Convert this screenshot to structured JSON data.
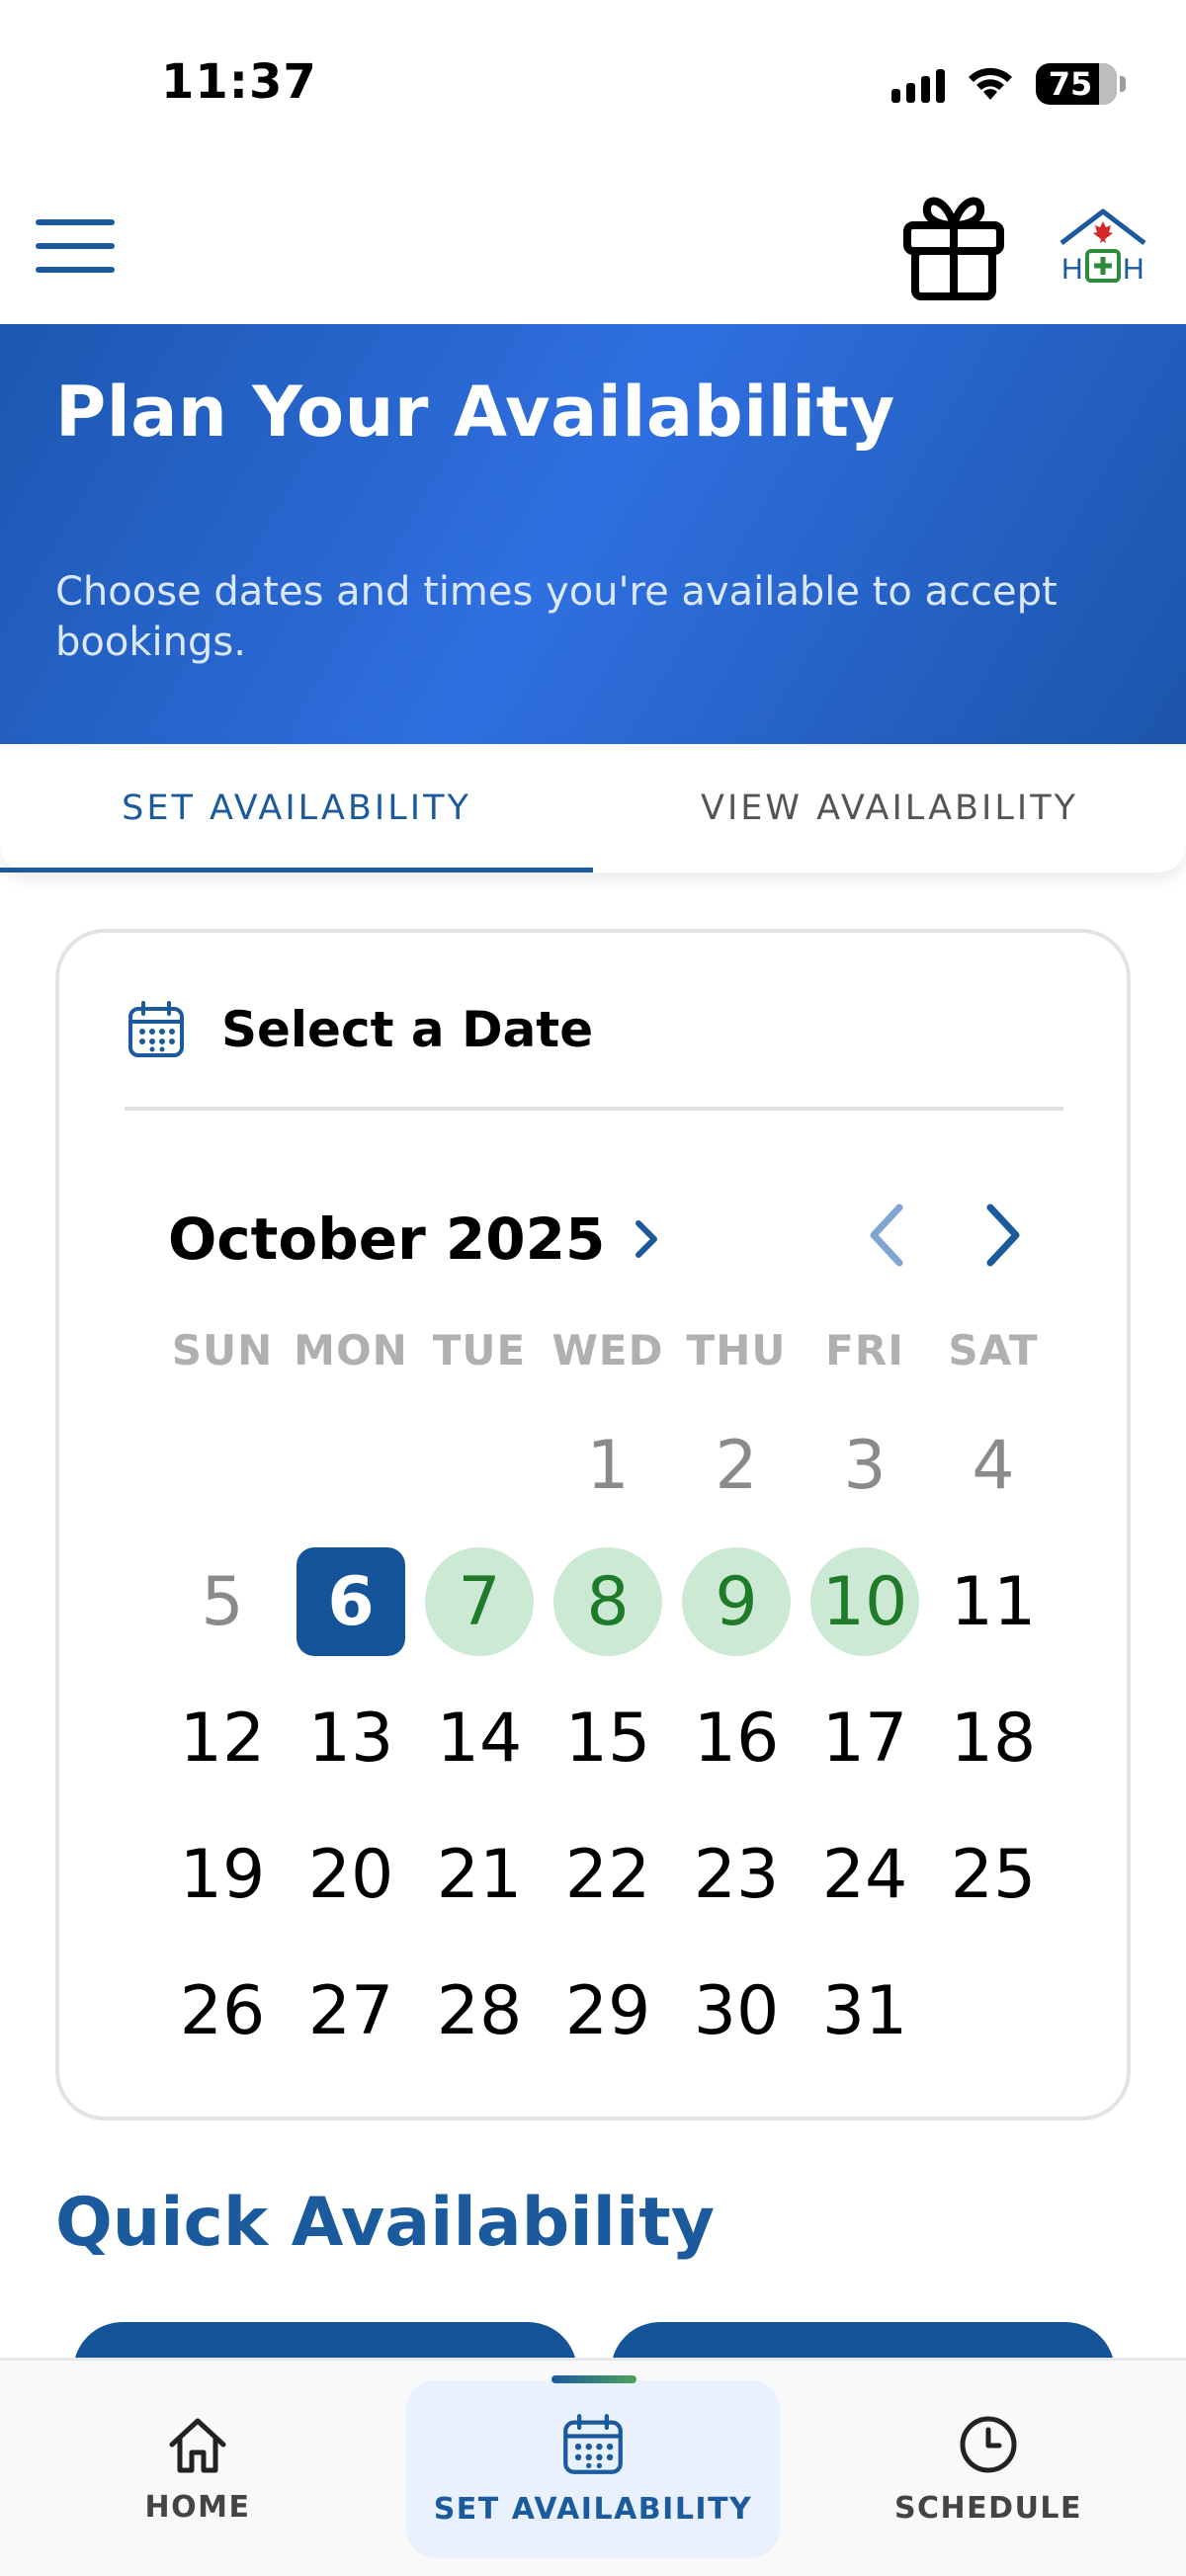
{
  "status_bar": {
    "time": "11:37",
    "battery": "75"
  },
  "header": {
    "menu_icon": "hamburger-menu-icon",
    "gift_icon": "gift-icon",
    "logo_icon": "house-maple-leaf-logo"
  },
  "hero": {
    "title": "Plan Your Availability",
    "subtitle": "Choose dates and times you're available to accept bookings."
  },
  "tabs": [
    {
      "label": "SET AVAILABILITY",
      "active": true
    },
    {
      "label": "VIEW AVAILABILITY",
      "active": false
    }
  ],
  "calendar": {
    "card_title": "Select a Date",
    "month_label": "October 2025",
    "weekdays": [
      "SUN",
      "MON",
      "TUE",
      "WED",
      "THU",
      "FRI",
      "SAT"
    ],
    "days": [
      "",
      "",
      "",
      "1",
      "2",
      "3",
      "4",
      "5",
      "6",
      "7",
      "8",
      "9",
      "10",
      "11",
      "12",
      "13",
      "14",
      "15",
      "16",
      "17",
      "18",
      "19",
      "20",
      "21",
      "22",
      "23",
      "24",
      "25",
      "26",
      "27",
      "28",
      "29",
      "30",
      "31"
    ],
    "past_days": [
      "1",
      "2",
      "3",
      "4",
      "5"
    ],
    "selected_day": "6",
    "available_days": [
      "7",
      "8",
      "9",
      "10"
    ]
  },
  "quick_availability": {
    "title": "Quick Availability"
  },
  "bottom_nav": {
    "home": "HOME",
    "set_availability": "SET AVAILABILITY",
    "schedule": "SCHEDULE"
  },
  "colors": {
    "primary": "#1b5a9c",
    "selected_day": "#155498",
    "available_bg": "#cbe9d3",
    "available_text": "#1f7a2a"
  }
}
